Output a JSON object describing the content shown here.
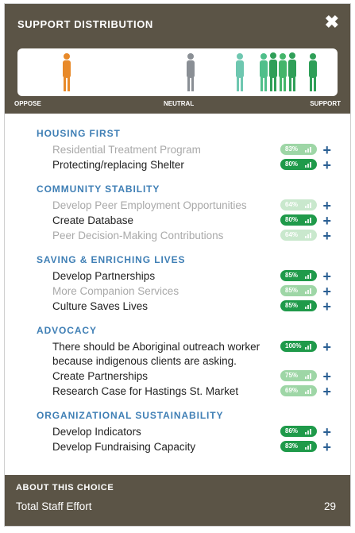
{
  "header": {
    "title": "SUPPORT DISTRIBUTION",
    "close_icon": "close-icon",
    "scale": {
      "left": "OPPOSE",
      "middle": "NEUTRAL",
      "right": "SUPPORT"
    }
  },
  "sections": [
    {
      "title": "HOUSING FIRST",
      "items": [
        {
          "label": "Residential Treatment Program",
          "pct": "83%",
          "muted": true,
          "tone": "light"
        },
        {
          "label": "Protecting/replacing Shelter",
          "pct": "80%",
          "muted": false,
          "tone": "dark"
        }
      ]
    },
    {
      "title": "COMMUNITY STABILITY",
      "items": [
        {
          "label": "Develop Peer Employment Opportunities",
          "pct": "64%",
          "muted": true,
          "tone": "lighter"
        },
        {
          "label": "Create Database",
          "pct": "80%",
          "muted": false,
          "tone": "dark"
        },
        {
          "label": "Peer Decision-Making Contributions",
          "pct": "64%",
          "muted": true,
          "tone": "lighter"
        }
      ]
    },
    {
      "title": "SAVING & ENRICHING LIVES",
      "items": [
        {
          "label": "Develop Partnerships",
          "pct": "85%",
          "muted": false,
          "tone": "dark"
        },
        {
          "label": "More Companion Services",
          "pct": "85%",
          "muted": true,
          "tone": "light"
        },
        {
          "label": "Culture Saves Lives",
          "pct": "85%",
          "muted": false,
          "tone": "dark"
        }
      ]
    },
    {
      "title": "ADVOCACY",
      "items": [
        {
          "label": "There should be Aboriginal outreach worker because indigenous clients are asking.",
          "pct": "100%",
          "muted": false,
          "tone": "dark"
        },
        {
          "label": "Create Partnerships",
          "pct": "75%",
          "muted": false,
          "tone": "light"
        },
        {
          "label": "Research Case for Hastings St. Market",
          "pct": "69%",
          "muted": false,
          "tone": "light"
        }
      ]
    },
    {
      "title": "ORGANIZATIONAL SUSTAINABILITY",
      "items": [
        {
          "label": "Develop Indicators",
          "pct": "86%",
          "muted": false,
          "tone": "dark"
        },
        {
          "label": "Develop Fundraising Capacity",
          "pct": "83%",
          "muted": false,
          "tone": "dark"
        }
      ]
    }
  ],
  "footer": {
    "title": "ABOUT THIS CHOICE",
    "effort_label": "Total Staff Effort",
    "effort_value": "29"
  },
  "colors": {
    "header_bg": "#5b5446",
    "section_title": "#3f7fb5",
    "plus": "#2a5f93",
    "badge_dark": "#1f9a4a",
    "badge_light": "#9ed6a6",
    "badge_lighter": "#c9e8cd",
    "oppose_figure": "#e88a2a",
    "neutral_figure": "#8a8f95",
    "support_light": "#6ec7b0",
    "support_green": "#2f9f58"
  }
}
